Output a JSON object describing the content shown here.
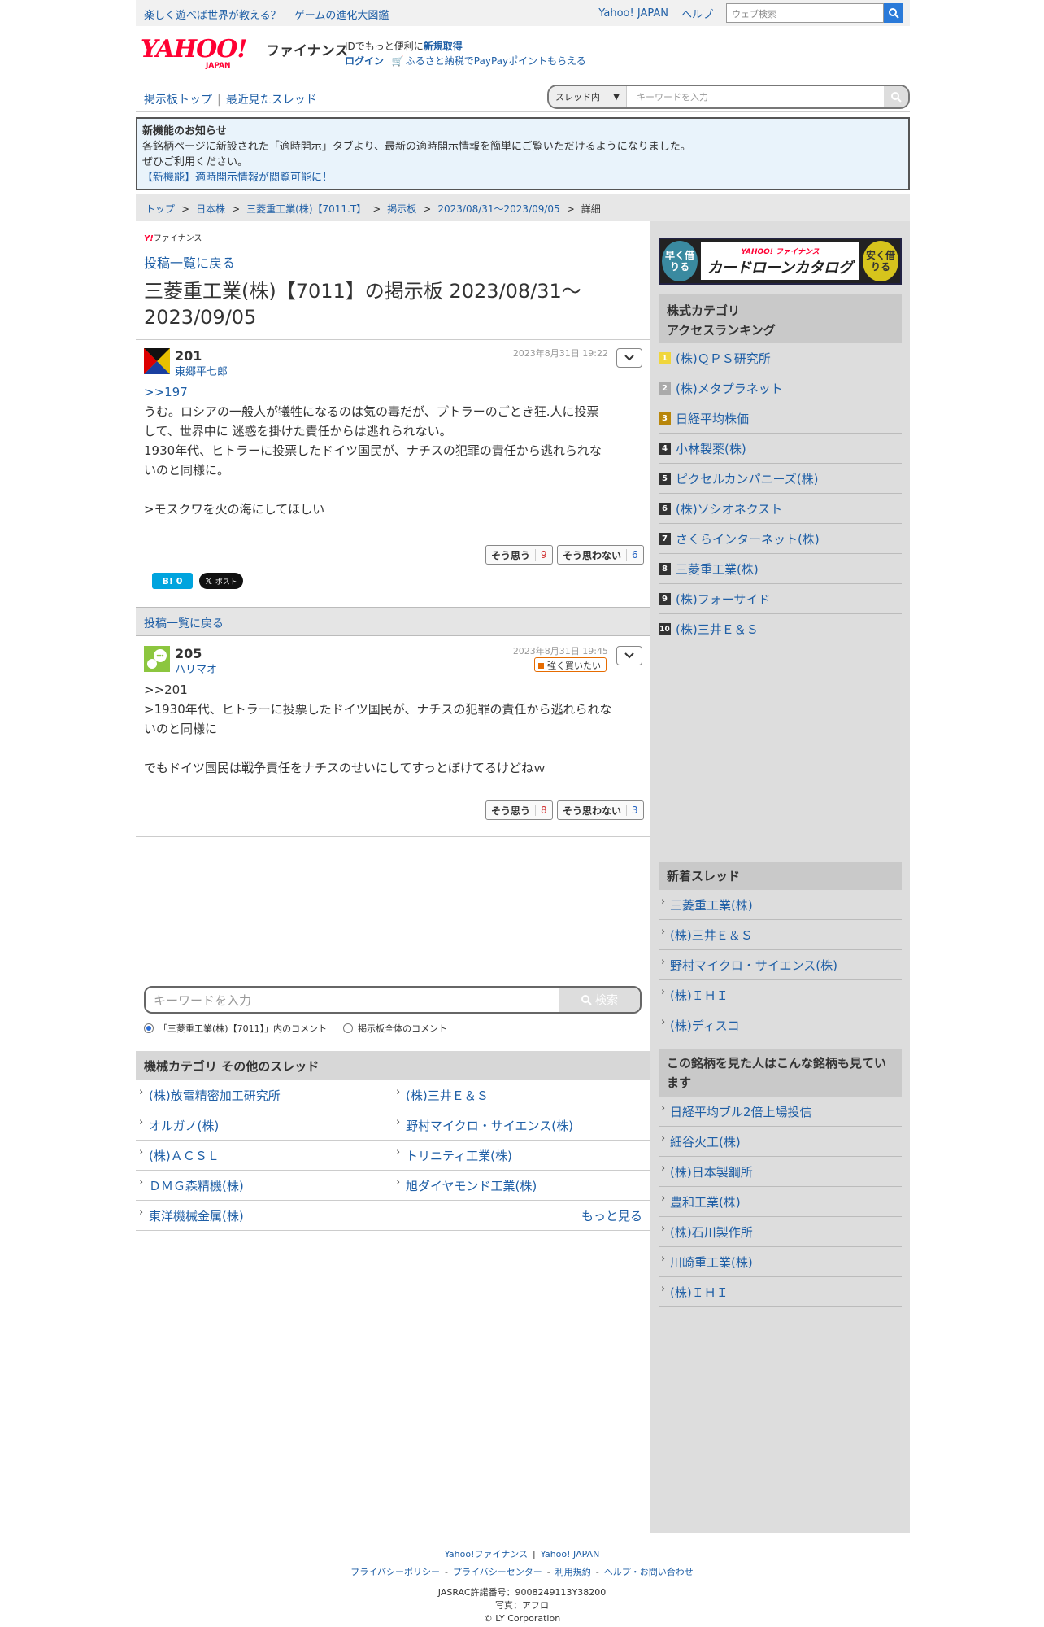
{
  "topbar": {
    "link1": "楽しく遊べば世界が教える？",
    "link2": "ゲームの進化大図鑑",
    "yahoo_japan": "Yahoo! JAPAN",
    "help": "ヘルプ",
    "search_placeholder": "ウェブ検索"
  },
  "header": {
    "logo_text": "YAHOO!",
    "logo_sub": "JAPAN",
    "finance": "ファイナンス",
    "line1_prefix": "IDでもっと便利に",
    "signup": "新規取得",
    "login": "ログイン",
    "promo": "ふるさと納税でPayPayポイントもらえる"
  },
  "nav": {
    "board_top": "掲示板トップ",
    "recent": "最近見たスレッド",
    "scope": "スレッド内",
    "search_placeholder": "キーワードを入力"
  },
  "notice": {
    "title": "新機能のお知らせ",
    "line1": "各銘柄ページに新設された「適時開示」タブより、最新の適時開示情報を簡単にご覧いただけるようになりました。",
    "line2": "ぜひご利用ください。",
    "link": "【新機能】適時開示情報が閲覧可能に！"
  },
  "breadcrumb": [
    "トップ",
    "日本株",
    "三菱重工業(株)【7011.T】",
    "掲示板",
    "2023/08/31〜2023/09/05",
    "詳細"
  ],
  "main": {
    "small_logo_y": "Y!",
    "small_logo_text": "ファイナンス",
    "back": "投稿一覧に戻る",
    "title": "三菱重工業(株)【7011】の掲示板 2023/08/31〜2023/09/05",
    "posts": [
      {
        "num": "201",
        "name": "東郷平七郎",
        "date": "2023年8月31日 19:22",
        "anchor": ">>197",
        "text": "うむ。ロシアの一般人が犠牲になるのは気の毒だが、プトラーのごとき狂.人に投票\nして、世界中に 迷惑を掛けた責任からは逃れられない。\n1930年代、ヒトラーに投票したドイツ国民が、ナチスの犯罪の責任から逃れられな\nいのと同様に。\n\n>モスクワを火の海にしてほしい",
        "agree": "そう思う",
        "agree_count": "9",
        "disagree": "そう思わない",
        "disagree_count": "6",
        "hatena": "B! 0",
        "x_post": "ポスト"
      },
      {
        "num": "205",
        "name": "ハリマオ",
        "date": "2023年8月31日 19:45",
        "badge": "強く買いたい",
        "text": ">>201\n>1930年代、ヒトラーに投票したドイツ国民が、ナチスの犯罪の責任から逃れられな\nいのと同様に\n\nでもドイツ国民は戦争責任をナチスのせいにしてすっとぼけてるけどねｗ",
        "agree": "そう思う",
        "agree_count": "8",
        "disagree": "そう思わない",
        "disagree_count": "3"
      }
    ],
    "back2": "投稿一覧に戻る",
    "kw_placeholder": "キーワードを入力",
    "kw_button": "検索",
    "radio1": "「三菱重工業(株)【7011】」内のコメント",
    "radio2": "掲示板全体のコメント",
    "category_head": "機械カテゴリ  その他のスレッド",
    "categories": [
      [
        "(株)放電精密加工研究所",
        "(株)三井Ｅ＆Ｓ"
      ],
      [
        "オルガノ(株)",
        "野村マイクロ・サイエンス(株)"
      ],
      [
        "(株)ＡＣＳＬ",
        "トリニティ工業(株)"
      ],
      [
        "ＤＭＧ森精機(株)",
        "旭ダイヤモンド工業(株)"
      ],
      [
        "東洋機械金属(株)",
        ""
      ]
    ],
    "more": "もっと見る"
  },
  "side": {
    "banner_left": "早く借りる",
    "banner_brand": "YAHOO! ファイナンス",
    "banner_title": "カードローンカタログ",
    "banner_right": "安く借りる",
    "ranking_head1": "株式カテゴリ",
    "ranking_head2": "アクセスランキング",
    "ranking": [
      "(株)ＱＰＳ研究所",
      "(株)メタプラネット",
      "日経平均株価",
      "小林製薬(株)",
      "ピクセルカンパニーズ(株)",
      "(株)ソシオネクスト",
      "さくらインターネット(株)",
      "三菱重工業(株)",
      "(株)フォーサイド",
      "(株)三井Ｅ＆Ｓ"
    ],
    "rank_nums": [
      "1",
      "2",
      "3",
      "4",
      "5",
      "6",
      "7",
      "8",
      "9",
      "10"
    ],
    "new_head": "新着スレッド",
    "new_threads": [
      "三菱重工業(株)",
      "(株)三井Ｅ＆Ｓ",
      "野村マイクロ・サイエンス(株)",
      "(株)ＩＨＩ",
      "(株)ディスコ"
    ],
    "also_head": "この銘柄を見た人はこんな銘柄も見ています",
    "also": [
      "日経平均ブル2倍上場投信",
      "細谷火工(株)",
      "(株)日本製鋼所",
      "豊和工業(株)",
      "(株)石川製作所",
      "川崎重工業(株)",
      "(株)ＩＨＩ"
    ]
  },
  "footer": {
    "l1": "Yahoo!ファイナンス",
    "l2": "Yahoo! JAPAN",
    "privacy": "プライバシーポリシー",
    "center": "プライバシーセンター",
    "terms": "利用規約",
    "help": "ヘルプ・お問い合わせ",
    "jasrac": "JASRAC許諾番号：9008249113Y38200",
    "photo": "写真：アフロ",
    "copy": "© LY Corporation"
  }
}
